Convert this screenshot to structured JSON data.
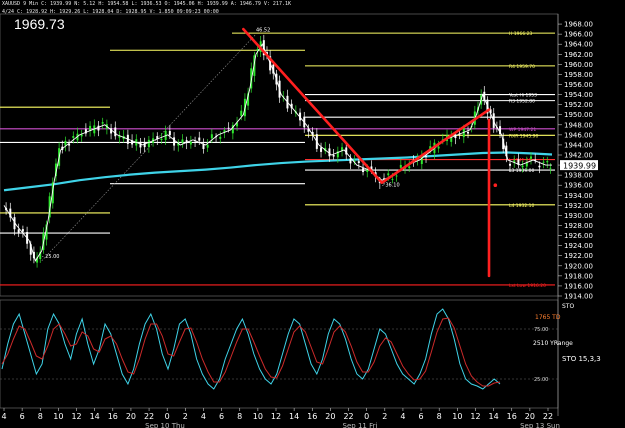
{
  "header": {
    "line1": "XAUUSD 9 Min  C: 1939.99  N: 5.12  H: 1954.58  L: 1936.53  O: 1945.06  H: 1939.99  A: 1946.79  V: 217.1K",
    "line2": "4/24  C: 1928.92  H: 1929.26  L: 1928.04  D: 1928.95  V: 1.850  09:09:23  00:00"
  },
  "last_price_big": "1969.73",
  "colors": {
    "background": "#000000",
    "cyan_ma": "#3fd3e8",
    "trend_red": "#ff2020",
    "yellow_level": "#ffff66",
    "magenta_level": "#d050d0",
    "white_level": "#ffffff"
  },
  "chart_data": [
    {
      "type": "candlestick-with-overlays",
      "y_axis": {
        "min": 1914,
        "max": 1970,
        "step": 2,
        "tick_labels": [
          "1968.00",
          "1966.00",
          "1964.00",
          "1962.00",
          "1960.00",
          "1958.00",
          "1956.00",
          "1954.00",
          "1952.00",
          "1950.00",
          "1948.00",
          "1946.00",
          "1944.00",
          "1942.00",
          "1940.00",
          "1938.00",
          "1936.00",
          "1934.00",
          "1932.00",
          "1930.00",
          "1928.00",
          "1926.00",
          "1924.00",
          "1922.00",
          "1920.00",
          "1918.00",
          "1916.00",
          "1914.00"
        ]
      },
      "current_price": {
        "label": "1939.99",
        "value": 1939.99
      },
      "levels": [
        {
          "label": "H 1966.23",
          "value": 1966.2,
          "color": "#ffff66"
        },
        {
          "label": "",
          "value": 1962.8,
          "color": "#ffff66"
        },
        {
          "label": "R4 1959.70",
          "value": 1959.7,
          "color": "#ffff66"
        },
        {
          "label": "Yest Hi 1953",
          "value": 1954.0,
          "color": "#ffffff"
        },
        {
          "label": "R3 1952.80",
          "value": 1952.8,
          "color": "#ffffff"
        },
        {
          "label": "",
          "value": 1951.5,
          "color": "#ffff66"
        },
        {
          "label": "",
          "value": 1949.5,
          "color": "#ffffff"
        },
        {
          "label": "WP 1947.21",
          "value": 1947.2,
          "color": "#d050d0"
        },
        {
          "label": "RXR 1945.90",
          "value": 1945.9,
          "color": "#ffff66"
        },
        {
          "label": "",
          "value": 1944.5,
          "color": "#ffffff"
        },
        {
          "label": "L 1941.10",
          "value": 1941.1,
          "color": "#ff3030"
        },
        {
          "label": "L3 1939.00",
          "value": 1939.0,
          "color": "#ffffff"
        },
        {
          "label": "",
          "value": 1936.3,
          "color": "#ffffff"
        },
        {
          "label": "L4 1932.10",
          "value": 1932.1,
          "color": "#ffff66"
        },
        {
          "label": "",
          "value": 1930.5,
          "color": "#ffff66"
        },
        {
          "label": "",
          "value": 1926.5,
          "color": "#ffffff"
        },
        {
          "label": "Lst Low 1916.20",
          "value": 1916.2,
          "color": "#ff2020"
        }
      ],
      "point_labels": [
        {
          "text": "46.52",
          "x": 40,
          "y": 1966.5
        },
        {
          "text": "- 25.00",
          "x": 6,
          "y": 1921.5
        },
        {
          "text": "- 36.10",
          "x": 60,
          "y": 1935.7
        }
      ],
      "price_path": [
        [
          0,
          1932
        ],
        [
          2,
          1928
        ],
        [
          4,
          1925
        ],
        [
          5,
          1921
        ],
        [
          6,
          1923
        ],
        [
          7,
          1929
        ],
        [
          8,
          1937
        ],
        [
          9,
          1943
        ],
        [
          10,
          1944
        ],
        [
          12,
          1946
        ],
        [
          14,
          1947
        ],
        [
          16,
          1948
        ],
        [
          18,
          1946
        ],
        [
          20,
          1945
        ],
        [
          22,
          1944
        ],
        [
          24,
          1945
        ],
        [
          26,
          1946
        ],
        [
          28,
          1944
        ],
        [
          30,
          1945
        ],
        [
          32,
          1944
        ],
        [
          34,
          1946
        ],
        [
          36,
          1947
        ],
        [
          38,
          1950
        ],
        [
          39,
          1955
        ],
        [
          40,
          1962
        ],
        [
          41,
          1964
        ],
        [
          42,
          1961
        ],
        [
          43,
          1958
        ],
        [
          44,
          1954
        ],
        [
          46,
          1951
        ],
        [
          48,
          1948
        ],
        [
          50,
          1944
        ],
        [
          52,
          1942
        ],
        [
          54,
          1943
        ],
        [
          56,
          1940
        ],
        [
          58,
          1939
        ],
        [
          60,
          1937
        ],
        [
          62,
          1938
        ],
        [
          64,
          1940
        ],
        [
          66,
          1941
        ],
        [
          68,
          1943
        ],
        [
          70,
          1945
        ],
        [
          72,
          1946
        ],
        [
          74,
          1947
        ],
        [
          75,
          1950
        ],
        [
          76,
          1954
        ],
        [
          77,
          1951
        ],
        [
          78,
          1948
        ],
        [
          79,
          1946
        ],
        [
          80,
          1941
        ],
        [
          82,
          1940
        ],
        [
          84,
          1941
        ],
        [
          86,
          1940
        ],
        [
          87,
          1940
        ]
      ],
      "moving_average": [
        [
          0,
          1935
        ],
        [
          4,
          1935.6
        ],
        [
          8,
          1936.2
        ],
        [
          12,
          1937
        ],
        [
          16,
          1937.6
        ],
        [
          20,
          1938.1
        ],
        [
          24,
          1938.5
        ],
        [
          28,
          1938.8
        ],
        [
          32,
          1939.1
        ],
        [
          36,
          1939.5
        ],
        [
          40,
          1940
        ],
        [
          44,
          1940.4
        ],
        [
          48,
          1940.7
        ],
        [
          52,
          1940.9
        ],
        [
          56,
          1941.1
        ],
        [
          60,
          1941.3
        ],
        [
          64,
          1941.5
        ],
        [
          68,
          1941.8
        ],
        [
          72,
          1942.1
        ],
        [
          76,
          1942.4
        ],
        [
          80,
          1942.5
        ],
        [
          84,
          1942.3
        ],
        [
          87,
          1942.1
        ]
      ],
      "trend_lines": [
        [
          [
            38,
            1967
          ],
          [
            60,
            1936.5
          ],
          [
            77,
            1951
          ]
        ],
        [
          [
            77,
            1949
          ],
          [
            77,
            1918
          ]
        ]
      ],
      "marker": {
        "x": 78,
        "y": 1936
      }
    },
    {
      "type": "line",
      "title": "STO 15,3,3",
      "y_ticks": [
        "25.00",
        "75.00"
      ],
      "annotations": [
        "1765 TD",
        "2510 YRange"
      ],
      "series": [
        {
          "color": "#3fd3e8",
          "values": [
            35,
            60,
            80,
            90,
            70,
            50,
            30,
            40,
            75,
            90,
            80,
            60,
            45,
            70,
            85,
            60,
            40,
            55,
            80,
            70,
            50,
            30,
            20,
            35,
            60,
            80,
            90,
            75,
            50,
            35,
            55,
            80,
            85,
            70,
            45,
            30,
            20,
            15,
            25,
            45,
            60,
            75,
            85,
            70,
            50,
            35,
            25,
            20,
            30,
            50,
            70,
            85,
            80,
            60,
            40,
            30,
            45,
            70,
            85,
            80,
            65,
            45,
            30,
            25,
            35,
            55,
            75,
            70,
            55,
            40,
            30,
            25,
            20,
            30,
            45,
            70,
            90,
            95,
            85,
            65,
            40,
            25,
            20,
            18,
            15,
            20,
            25,
            20
          ]
        },
        {
          "color": "#cc2a2a",
          "values": [
            40,
            50,
            65,
            78,
            75,
            62,
            48,
            45,
            58,
            75,
            80,
            70,
            58,
            60,
            72,
            68,
            55,
            52,
            65,
            68,
            60,
            45,
            32,
            30,
            45,
            65,
            80,
            80,
            68,
            50,
            48,
            62,
            75,
            76,
            62,
            45,
            32,
            22,
            22,
            32,
            47,
            62,
            75,
            75,
            62,
            48,
            35,
            27,
            26,
            38,
            55,
            72,
            78,
            72,
            57,
            42,
            40,
            55,
            72,
            78,
            72,
            58,
            42,
            32,
            32,
            42,
            58,
            66,
            62,
            50,
            38,
            30,
            24,
            25,
            33,
            52,
            72,
            85,
            86,
            76,
            58,
            40,
            28,
            22,
            18,
            18,
            21,
            22
          ]
        }
      ]
    }
  ],
  "x_axis": {
    "labels": [
      "4",
      "6",
      "8",
      "10",
      "12",
      "14",
      "16",
      "20",
      "22",
      "0",
      "2",
      "4",
      "6",
      "8",
      "10",
      "12",
      "14",
      "16",
      "20",
      "22",
      "0",
      "2",
      "4",
      "6",
      "8",
      "10",
      "12",
      "14",
      "16",
      "20",
      "22"
    ],
    "date_labels": [
      "Sep 10 Thu",
      "Sep 11 Fri",
      "Sep 13 Sun"
    ]
  }
}
